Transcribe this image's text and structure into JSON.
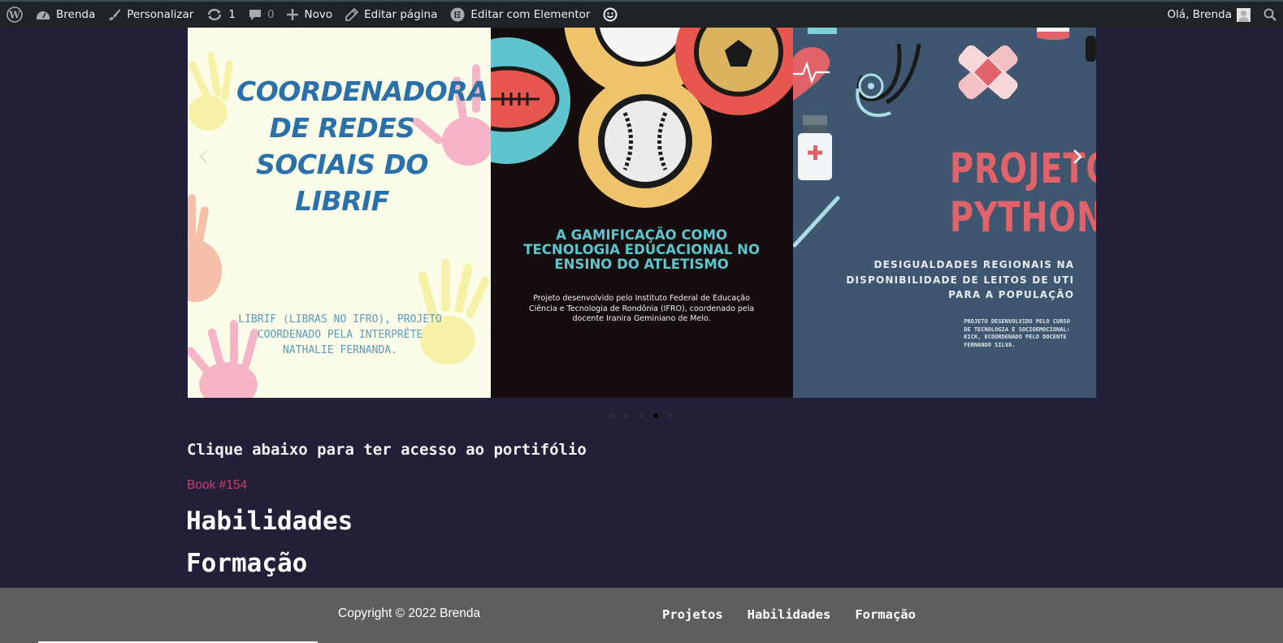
{
  "admin_bar": {
    "wp_logo_icon": "wordpress-icon",
    "site_name": "Brenda",
    "customize": "Personalizar",
    "updates_count": "1",
    "comments_count": "0",
    "new": "Novo",
    "edit_page": "Editar página",
    "edit_elementor": "Editar com Elementor",
    "greeting": "Olá, Brenda"
  },
  "carousel": {
    "slides": [
      {
        "title": "COORDENADORA DE REDES SOCIAIS DO LIBRIF",
        "subtitle": "LIBRIF (LIBRAS NO IFRO), PROJETO COORDENADO PELA INTERPRÊTE NATHALIE FERNANDA."
      },
      {
        "title": "A GAMIFICAÇÃO COMO TECNOLOGIA EDÚCACIONAL NO ENSINO DO ATLETISMO",
        "subtitle": "Projeto desenvolvido pelo Instituto Federal de Educação Ciência e Tecnologia de Rondônia (IFRO), coordenado pela docente Iranira Geminiano de Melo."
      },
      {
        "title": "PROJETO PYTHON",
        "subtitle": "DESIGUALDADES REGIONAIS NA DISPONIBILIDADE DE LEITOS DE UTI PARA A POPULAÇÃO",
        "note": "PROJETO DESENVOLVIDO PELO CURSO DE TECNOLOGIA E SOCIOEMOCIONAL: KICK, ECOORDENADO PELO DOCENTE FERNANDO SILVA."
      }
    ],
    "dots_total": 5,
    "active_dot": 4
  },
  "content": {
    "access_text": "Clique abaixo para ter acesso ao portifólio",
    "book_link": "Book #154",
    "heading_skills": "Habilidades",
    "heading_formation": "Formação"
  },
  "footer": {
    "copyright": "Copyright © 2022 Brenda",
    "nav": [
      "Projetos",
      "Habilidades",
      "Formação"
    ]
  },
  "colors": {
    "page_bg": "#231f38",
    "admin_bar": "#1d2327",
    "footer_bg": "#5c5f5e",
    "link": "#d63a6b"
  }
}
